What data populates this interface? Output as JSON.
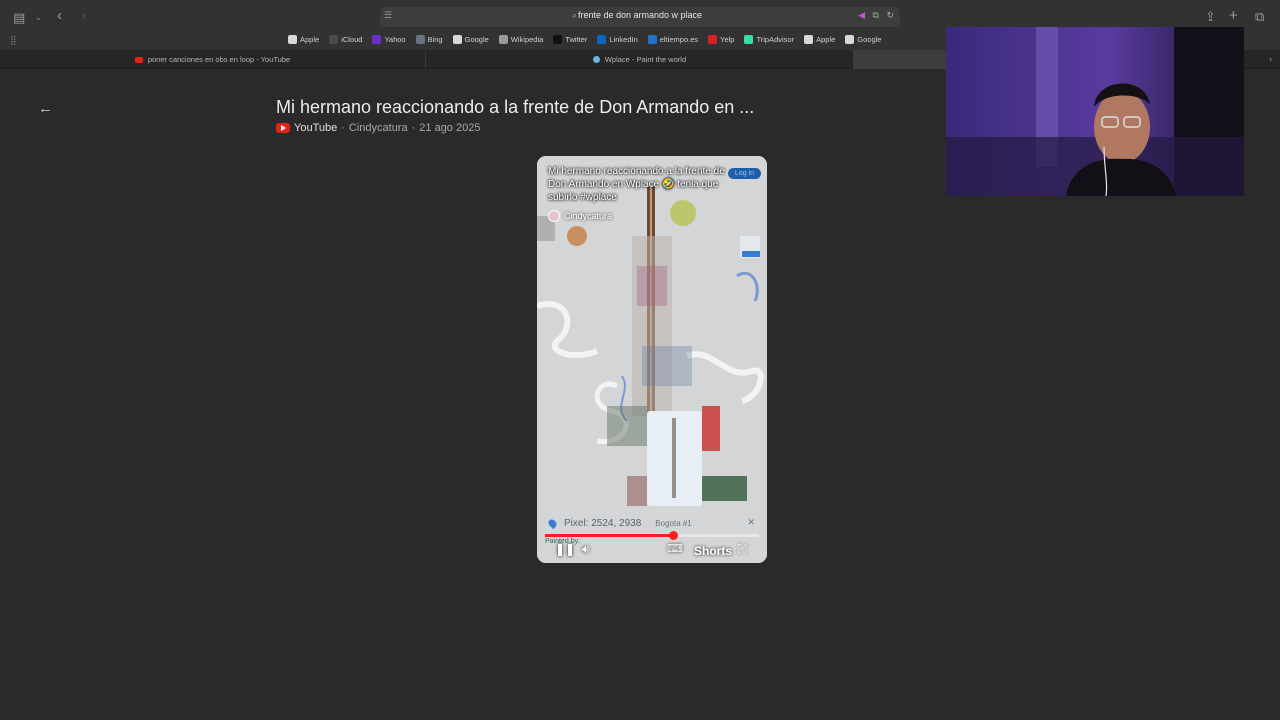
{
  "browser": {
    "address": {
      "query": "frente de don armando w place"
    },
    "bookmarks": [
      {
        "label": "Apple",
        "icon": "apple-icon",
        "color": "#d8d8d8"
      },
      {
        "label": "iCloud",
        "icon": "icloud-icon",
        "color": "#4a4a4a"
      },
      {
        "label": "Yahoo",
        "icon": "yahoo-icon",
        "color": "#6a2fc9"
      },
      {
        "label": "Bing",
        "icon": "bing-icon",
        "color": "#6b7280"
      },
      {
        "label": "Google",
        "icon": "google-icon",
        "color": "#d8d8d8"
      },
      {
        "label": "Wikipedia",
        "icon": "wikipedia-icon",
        "color": "#9a9a9a"
      },
      {
        "label": "Twitter",
        "icon": "x-icon",
        "color": "#111111"
      },
      {
        "label": "LinkedIn",
        "icon": "linkedin-icon",
        "color": "#0a66c2"
      },
      {
        "label": "eltiempo.es",
        "icon": "eltiempo-icon",
        "color": "#1e73c9"
      },
      {
        "label": "Yelp",
        "icon": "yelp-icon",
        "color": "#d32323"
      },
      {
        "label": "TripAdvisor",
        "icon": "tripadvisor-icon",
        "color": "#34e0a1"
      },
      {
        "label": "Apple",
        "icon": "apple-icon",
        "color": "#d8d8d8"
      },
      {
        "label": "Google",
        "icon": "google-icon",
        "color": "#d8d8d8"
      }
    ],
    "tabs": [
      {
        "label": "poner canciones en obs en loop - YouTube",
        "icon": "youtube-icon"
      },
      {
        "label": "Wplace - Paint the world",
        "icon": "wplace-icon"
      }
    ]
  },
  "page": {
    "title": "Mi hermano reaccionando a la frente de Don Armando en ...",
    "source": "YouTube",
    "channel": "Cindycatura",
    "date": "21 ago 2025",
    "sep": "·"
  },
  "player": {
    "overlay_title": "Mi hermano reaccionando a la frente de Don Armando en Wplace 🤣 tenia que subirlo #wplace",
    "overlay_channel": "Cindycatura",
    "login_label": "Log in",
    "pixel_text": "Pixel: 2524, 2938",
    "region_text": "Bogota #1",
    "painted_text": "Painted by:",
    "shorts_label": "Shorts",
    "progress": 0.6
  },
  "colors": {
    "background": "#2a2a2a",
    "progress": "#ff1e1e",
    "accent": "#1f5ea8"
  }
}
